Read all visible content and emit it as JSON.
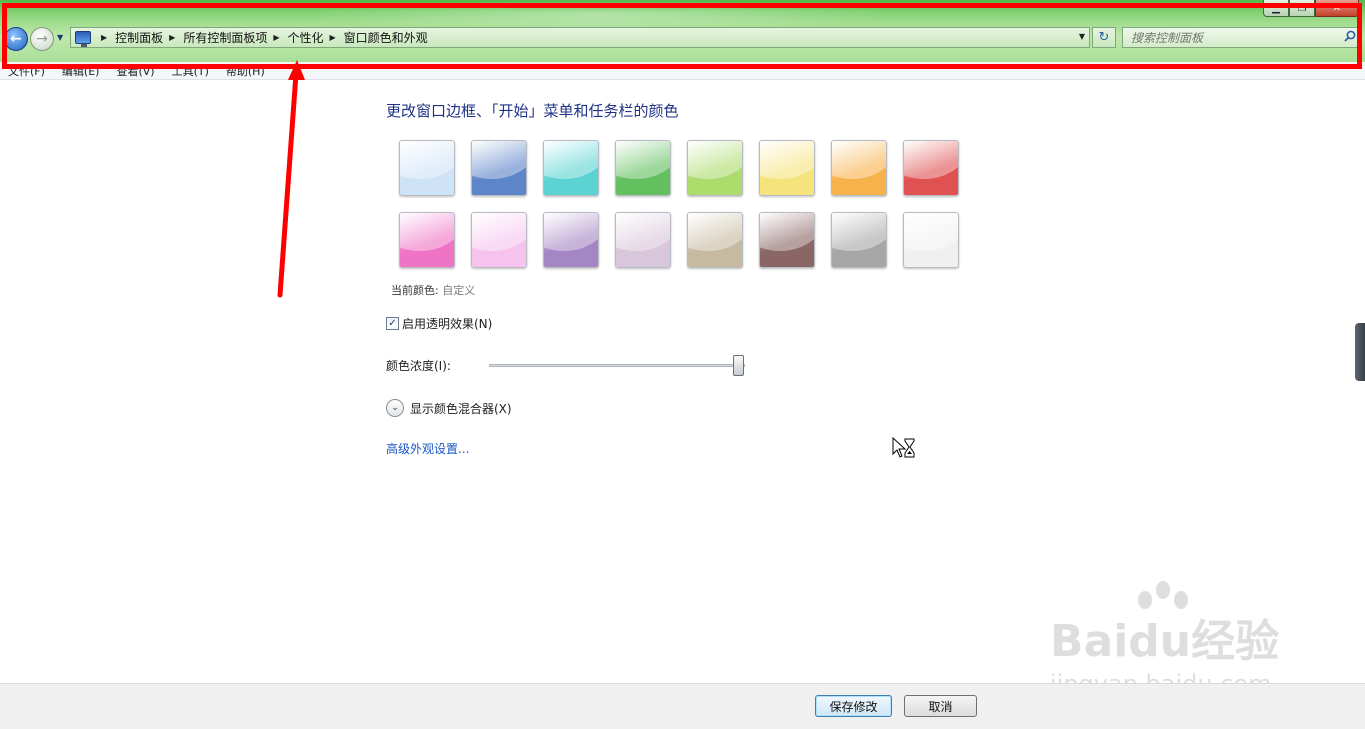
{
  "window": {
    "min_glyph": "▁",
    "max_glyph": "❐",
    "close_glyph": "✕"
  },
  "nav": {
    "back_glyph": "←",
    "forward_glyph": "→",
    "dropdown_glyph": "▼"
  },
  "breadcrumb": {
    "items": [
      "控制面板",
      "所有控制面板项",
      "个性化",
      "窗口颜色和外观"
    ],
    "separator": "▶",
    "dropdown_glyph": "▼"
  },
  "refresh_glyph": "↻",
  "search": {
    "placeholder": "搜索控制面板",
    "icon": "search-icon"
  },
  "menu": {
    "items": [
      "文件(F)",
      "编辑(E)",
      "查看(V)",
      "工具(T)",
      "帮助(H)"
    ]
  },
  "main": {
    "title": "更改窗口边框、「开始」菜单和任务栏的颜色",
    "swatches": [
      {
        "name": "sky",
        "color": "#cfe3f7"
      },
      {
        "name": "twilight",
        "color": "#5d85c9"
      },
      {
        "name": "sea",
        "color": "#5cd3d3"
      },
      {
        "name": "leaf",
        "color": "#62c05e"
      },
      {
        "name": "lime",
        "color": "#acdc6c"
      },
      {
        "name": "sun",
        "color": "#f5e47c"
      },
      {
        "name": "pumpkin",
        "color": "#f8b24c"
      },
      {
        "name": "ruby",
        "color": "#e05252"
      },
      {
        "name": "fuchsia",
        "color": "#ef74c6"
      },
      {
        "name": "blush",
        "color": "#f6c3ee"
      },
      {
        "name": "violet",
        "color": "#a586c4"
      },
      {
        "name": "lavender",
        "color": "#d8c6da"
      },
      {
        "name": "taupe",
        "color": "#c6baa0"
      },
      {
        "name": "chocolate",
        "color": "#8a6666"
      },
      {
        "name": "slate",
        "color": "#a6a6a6"
      },
      {
        "name": "frost",
        "color": "#f0f0f0"
      }
    ],
    "current_color_label": "当前颜色:",
    "current_color_value": "自定义",
    "transparency_label": "启用透明效果(N)",
    "transparency_checked": true,
    "check_glyph": "✓",
    "intensity_label": "颜色浓度(I):",
    "intensity_level": 1.0,
    "mixer_label": "显示颜色混合器(X)",
    "mixer_glyph": "⌄",
    "advanced_link": "高级外观设置..."
  },
  "watermark": {
    "logo": "Baidu经验",
    "sub": "jingyan.baidu.com"
  },
  "footer": {
    "save_label": "保存修改",
    "cancel_label": "取消"
  },
  "colors": {
    "annotation": "#ff0000",
    "title": "#1e3287",
    "link": "#1a56c5"
  }
}
